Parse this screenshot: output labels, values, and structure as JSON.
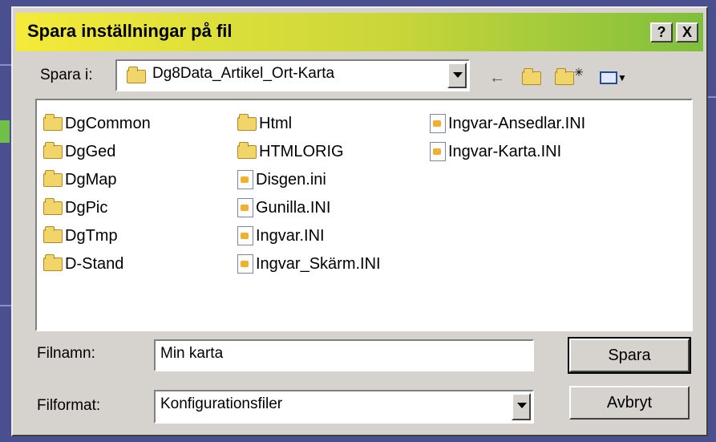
{
  "dialog": {
    "title": "Spara inställningar på fil",
    "help_label": "?",
    "close_label": "X"
  },
  "location": {
    "label": "Spara i:",
    "value": "Dg8Data_Artikel_Ort-Karta"
  },
  "toolbar": {
    "back_icon": "←",
    "up_icon": "up-folder-icon",
    "new_folder_icon": "new-folder-icon",
    "view_icon": "view-menu-icon"
  },
  "files": {
    "col1": [
      {
        "name": "DgCommon",
        "type": "folder"
      },
      {
        "name": "DgGed",
        "type": "folder"
      },
      {
        "name": "DgMap",
        "type": "folder"
      },
      {
        "name": "DgPic",
        "type": "folder"
      },
      {
        "name": "DgTmp",
        "type": "folder"
      },
      {
        "name": "D-Stand",
        "type": "folder"
      }
    ],
    "col2": [
      {
        "name": "Html",
        "type": "folder"
      },
      {
        "name": "HTMLORIG",
        "type": "folder"
      },
      {
        "name": "Disgen.ini",
        "type": "ini"
      },
      {
        "name": "Gunilla.INI",
        "type": "ini"
      },
      {
        "name": "Ingvar.INI",
        "type": "ini"
      },
      {
        "name": "Ingvar_Skärm.INI",
        "type": "ini"
      }
    ],
    "col3": [
      {
        "name": "Ingvar-Ansedlar.INI",
        "type": "ini"
      },
      {
        "name": "Ingvar-Karta.INI",
        "type": "ini"
      }
    ]
  },
  "filename": {
    "label": "Filnamn:",
    "value": "Min karta"
  },
  "filetype": {
    "label": "Filformat:",
    "value": "Konfigurationsfiler"
  },
  "buttons": {
    "save": "Spara",
    "cancel": "Avbryt"
  },
  "colors": {
    "title_gradient_start": "#f4ea3a",
    "title_gradient_end": "#7fbf3c",
    "dialog_face": "#d6d3ce"
  }
}
